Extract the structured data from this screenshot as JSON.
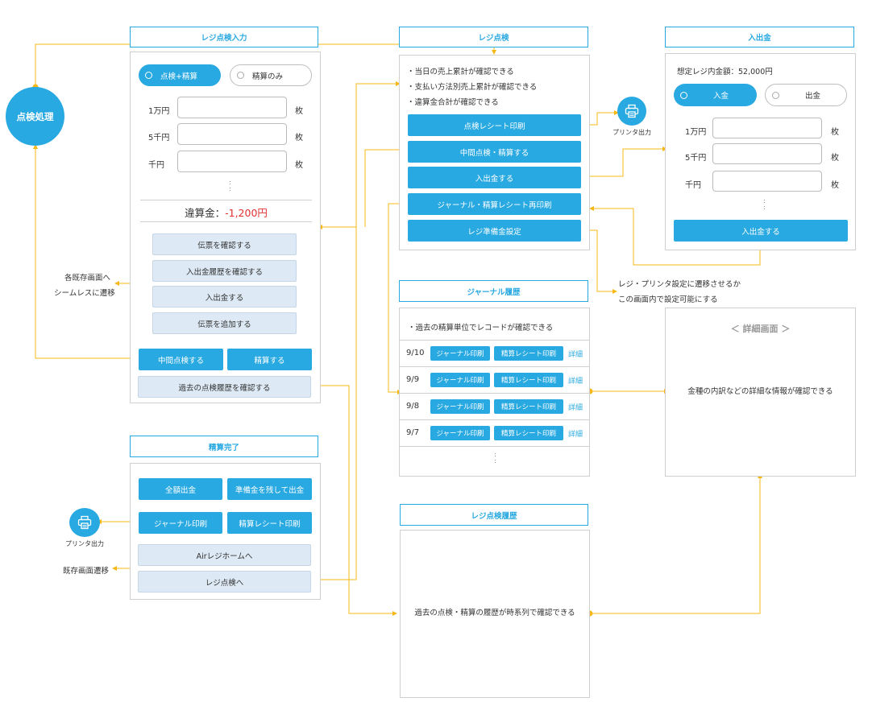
{
  "colors": {
    "primary": "#29a9e1",
    "connector": "#f5b817",
    "red": "#e03030"
  },
  "node_process": "点検処理",
  "check_input": {
    "title": "レジ点検入力",
    "radio_on": "点検+精算",
    "radio_off": "精算のみ",
    "rows": [
      {
        "label": "1万円",
        "unit": "枚"
      },
      {
        "label": "5千円",
        "unit": "枚"
      },
      {
        "label": "千円",
        "unit": "枚"
      }
    ],
    "ellipsis": ":",
    "diff_label": "違算金：",
    "diff_value": "-1,200円",
    "grey_buttons": [
      "伝票を確認する",
      "入出金履歴を確認する",
      "入出金する",
      "伝票を追加する"
    ],
    "mid_button": "中間点検する",
    "settle_button": "精算する",
    "history_button": "過去の点検履歴を確認する"
  },
  "note_existing": {
    "line1": "各既存画面へ",
    "line2": "シームレスに遷移"
  },
  "check": {
    "title": "レジ点検",
    "bullets": [
      "・当日の売上累計が確認できる",
      "・支払い方法別売上累計が確認できる",
      "・違算金合計が確認できる"
    ],
    "buttons": [
      "点検レシート印刷",
      "中間点検・精算する",
      "入出金する",
      "ジャーナル・精算レシート再印刷",
      "レジ準備金設定"
    ]
  },
  "printer_label": "プリンタ出力",
  "deposit": {
    "title": "入出金",
    "expected": "想定レジ内金額：52,000円",
    "radio_on": "入金",
    "radio_off": "出金",
    "rows": [
      {
        "label": "1万円",
        "unit": "枚"
      },
      {
        "label": "5千円",
        "unit": "枚"
      },
      {
        "label": "千円",
        "unit": "枚"
      }
    ],
    "ellipsis": ":",
    "submit": "入出金する"
  },
  "note_settings": {
    "line1": "レジ・プリンタ設定に遷移させるか",
    "line2": "この画面内で設定可能にする"
  },
  "journal": {
    "title": "ジャーナル履歴",
    "desc": "・過去の精算単位でレコードが確認できる",
    "print_journal": "ジャーナル印刷",
    "print_receipt": "精算レシート印刷",
    "detail": "詳細",
    "rows": [
      {
        "date": "9/10"
      },
      {
        "date": "9/9"
      },
      {
        "date": "9/8"
      },
      {
        "date": "9/7"
      }
    ],
    "ellipsis": ":"
  },
  "detail_screen": {
    "title": "＜ 詳細画面 ＞",
    "desc": "金種の内訳などの詳細な情報が確認できる"
  },
  "settle_done": {
    "title": "精算完了",
    "buttons": [
      "全額出金",
      "準備金を残して出金",
      "ジャーナル印刷",
      "精算レシート印刷"
    ],
    "grey_buttons": [
      "Airレジホームへ",
      "レジ点検へ"
    ]
  },
  "note_transition": "既存画面遷移",
  "check_history": {
    "title": "レジ点検履歴",
    "desc": "過去の点検・精算の履歴が時系列で確認できる"
  }
}
